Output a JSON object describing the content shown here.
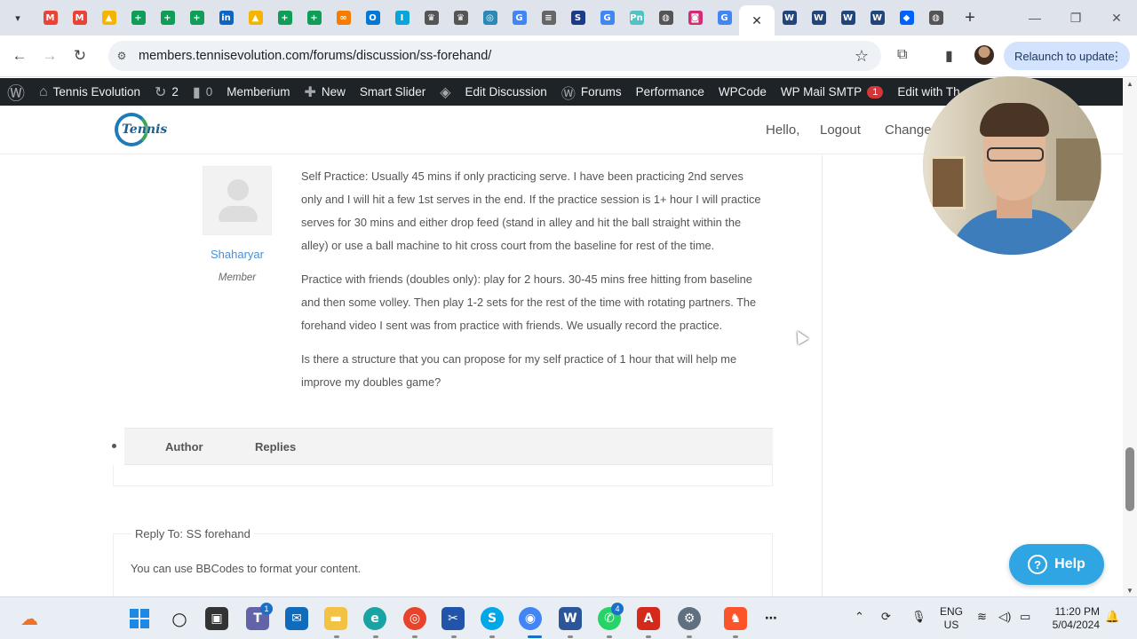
{
  "browser": {
    "tabs": [
      {
        "icon": "gmail-icon",
        "glyph": "M",
        "color": "#ea4335"
      },
      {
        "icon": "gmail-icon",
        "glyph": "M",
        "color": "#ea4335"
      },
      {
        "icon": "drive-icon",
        "glyph": "▲",
        "color": "#f4b400"
      },
      {
        "icon": "sheets-icon",
        "glyph": "+",
        "color": "#0f9d58"
      },
      {
        "icon": "sheets-icon",
        "glyph": "+",
        "color": "#0f9d58"
      },
      {
        "icon": "sheets-icon",
        "glyph": "+",
        "color": "#0f9d58"
      },
      {
        "icon": "linkedin-icon",
        "glyph": "in",
        "color": "#0a66c2"
      },
      {
        "icon": "drive-icon",
        "glyph": "▲",
        "color": "#f4b400"
      },
      {
        "icon": "sheets-icon",
        "glyph": "+",
        "color": "#0f9d58"
      },
      {
        "icon": "sheets-icon",
        "glyph": "+",
        "color": "#0f9d58"
      },
      {
        "icon": "chain-icon",
        "glyph": "∞",
        "color": "#f57c00"
      },
      {
        "icon": "outlook-icon",
        "glyph": "O",
        "color": "#0078d4"
      },
      {
        "icon": "info-icon",
        "glyph": "I",
        "color": "#0aa5d8"
      },
      {
        "icon": "crest-icon",
        "glyph": "♛",
        "color": "#555555"
      },
      {
        "icon": "crest-icon",
        "glyph": "♛",
        "color": "#555555"
      },
      {
        "icon": "globe-icon",
        "glyph": "◎",
        "color": "#2a8ab5"
      },
      {
        "icon": "google-icon",
        "glyph": "G",
        "color": "#4285f4"
      },
      {
        "icon": "chat-icon",
        "glyph": "≡",
        "color": "#666666"
      },
      {
        "icon": "sport-icon",
        "glyph": "S",
        "color": "#1a3b8a"
      },
      {
        "icon": "google-icon",
        "glyph": "G",
        "color": "#4285f4"
      },
      {
        "icon": "pn-icon",
        "glyph": "Pn",
        "color": "#4fc3c3"
      },
      {
        "icon": "globe-icon",
        "glyph": "◍",
        "color": "#555555"
      },
      {
        "icon": "instagram-icon",
        "glyph": "◙",
        "color": "#d62976"
      },
      {
        "icon": "google-icon",
        "glyph": "G",
        "color": "#4285f4"
      },
      {
        "icon": "wordpress-icon",
        "glyph": "W",
        "color": "#21447a"
      },
      {
        "icon": "wordpress-icon",
        "glyph": "W",
        "color": "#21447a"
      },
      {
        "icon": "wordpress-icon",
        "glyph": "W",
        "color": "#21447a"
      },
      {
        "icon": "wordpress-icon",
        "glyph": "W",
        "color": "#21447a"
      },
      {
        "icon": "dropbox-icon",
        "glyph": "◆",
        "color": "#0061fe"
      },
      {
        "icon": "globe-icon",
        "glyph": "◍",
        "color": "#555555"
      }
    ],
    "active_tab_index": 23,
    "url": "members.tennisevolution.com/forums/discussion/ss-forehand/",
    "relaunch_label": "Relaunch to update"
  },
  "adminbar": {
    "site_name": "Tennis Evolution",
    "updates_count": "2",
    "comments_count": "0",
    "items": [
      "Memberium",
      "New",
      "Smart Slider",
      "Edit Discussion",
      "Forums",
      "Performance",
      "WPCode",
      "WP Mail SMTP",
      "Edit with Th"
    ],
    "smtp_badge": "1"
  },
  "site": {
    "logo_text": "Tennis",
    "nav": [
      "Hello,",
      "Logout",
      "Change"
    ]
  },
  "post": {
    "author": "Shaharyar",
    "role": "Member",
    "paragraphs": [
      "Self Practice: Usually 45 mins if only practicing serve. I have been practicing 2nd serves only and I will hit a few 1st serves in the end. If the practice session is 1+ hour I will practice serves for 30 mins and either drop feed (stand in alley and hit the ball straight within the alley) or use a ball machine to hit cross court from the baseline for rest of the time.",
      "Practice with friends (doubles only): play for 2 hours. 30-45 mins free hitting from baseline and then some volley. Then play 1-2 sets for the rest of the time with rotating partners. The forehand video I sent was from practice with friends. We usually record the practice.",
      "Is there a structure that you can propose for my self practice of 1 hour that will help me improve my doubles game?"
    ]
  },
  "table_header": {
    "author": "Author",
    "replies": "Replies"
  },
  "reply": {
    "legend": "Reply To: SS forehand",
    "bbcodes": "You can use BBCodes to format your content."
  },
  "help_label": "Help",
  "taskbar": {
    "lang_top": "ENG",
    "lang_bottom": "US",
    "time": "11:20 PM",
    "date": "5/04/2024",
    "teams_badge": "1",
    "whatsapp_badge": "4"
  }
}
